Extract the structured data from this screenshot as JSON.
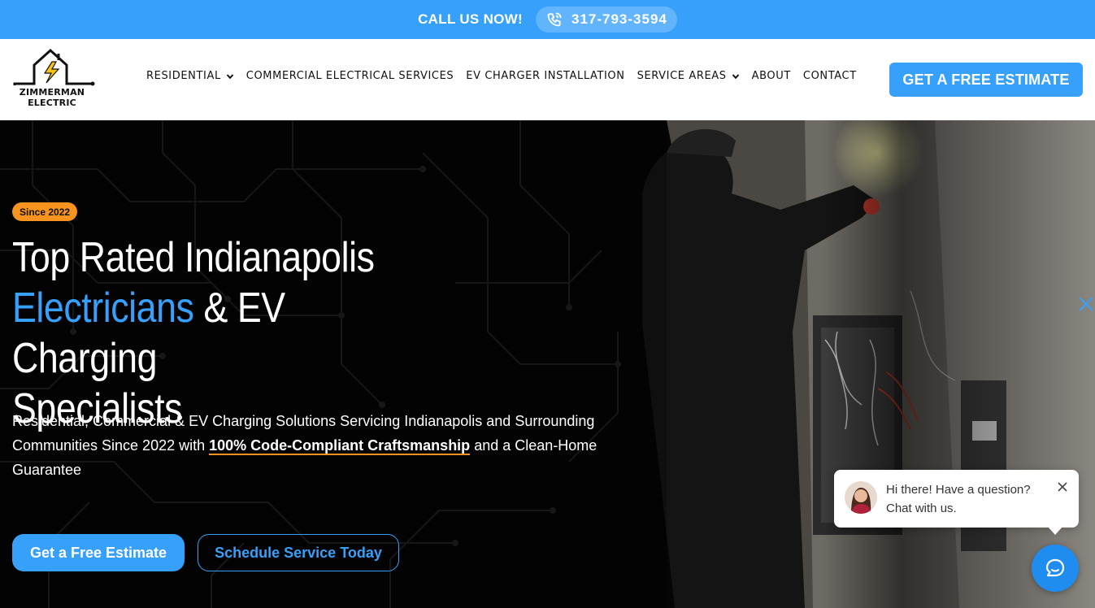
{
  "topbar": {
    "call_label": "CALL US NOW!",
    "phone": "317-793-3594",
    "phone_icon": "phone-icon"
  },
  "header": {
    "logo_line1": "ZIMMERMAN",
    "logo_line2": "ELECTRIC",
    "nav": [
      {
        "label": "RESIDENTIAL",
        "has_dropdown": true
      },
      {
        "label": "COMMERCIAL ELECTRICAL SERVICES",
        "has_dropdown": false
      },
      {
        "label": "EV CHARGER INSTALLATION",
        "has_dropdown": false
      },
      {
        "label": "SERVICE AREAS",
        "has_dropdown": true
      },
      {
        "label": "ABOUT",
        "has_dropdown": false
      },
      {
        "label": "CONTACT",
        "has_dropdown": false
      }
    ],
    "cta_label": "GET A FREE ESTIMATE"
  },
  "hero": {
    "badge": "Since 2022",
    "headline_line1": "Top Rated Indianapolis",
    "headline_blue": "Electricians",
    "headline_line2_rest": " & EV Charging",
    "headline_line3": "Specialists",
    "sub_part1": "Residential, Commercial & EV Charging Solutions Servicing Indianapolis and Surrounding Communities Since 2022 with ",
    "sub_highlight": "100% Code-Compliant Craftsmanship",
    "sub_part2": " and a Clean-Home Guarantee",
    "btn_primary": "Get a Free Estimate",
    "btn_secondary": "Schedule Service Today"
  },
  "chat": {
    "line1": "Hi there! Have a question?",
    "line2": "Chat with us."
  },
  "colors": {
    "accent": "#37a0fb",
    "badge": "#f7931e",
    "launcher": "#1f8cf0"
  }
}
